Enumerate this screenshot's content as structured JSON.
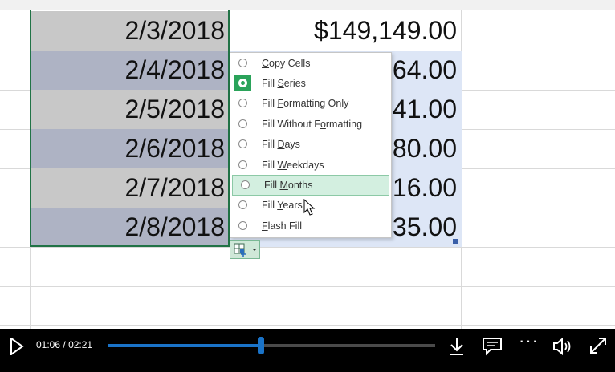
{
  "sheet": {
    "dates": [
      "2/3/2018",
      "2/4/2018",
      "2/5/2018",
      "2/6/2018",
      "2/7/2018",
      "2/8/2018"
    ],
    "values": [
      "$149,149.00",
      "64.00",
      "41.00",
      "80.00",
      "16.00",
      "35.00"
    ]
  },
  "autofill_menu": {
    "items": [
      {
        "before": "",
        "key": "C",
        "after": "opy Cells"
      },
      {
        "before": "Fill ",
        "key": "S",
        "after": "eries"
      },
      {
        "before": "Fill ",
        "key": "F",
        "after": "ormatting Only"
      },
      {
        "before": "Fill Without F",
        "key": "o",
        "after": "rmatting"
      },
      {
        "before": "Fill ",
        "key": "D",
        "after": "ays"
      },
      {
        "before": "Fill ",
        "key": "W",
        "after": "eekdays"
      },
      {
        "before": "Fill ",
        "key": "M",
        "after": "onths"
      },
      {
        "before": "Fill ",
        "key": "Y",
        "after": "ears"
      },
      {
        "before": "",
        "key": "F",
        "after": "lash Fill"
      }
    ],
    "selected_index": 1,
    "hovered_index": 6
  },
  "player": {
    "current_time": "01:06",
    "separator": "/",
    "duration": "02:21",
    "progress": 0.468
  },
  "colors": {
    "excel_green": "#217346",
    "progress_blue": "#1a73c8"
  }
}
